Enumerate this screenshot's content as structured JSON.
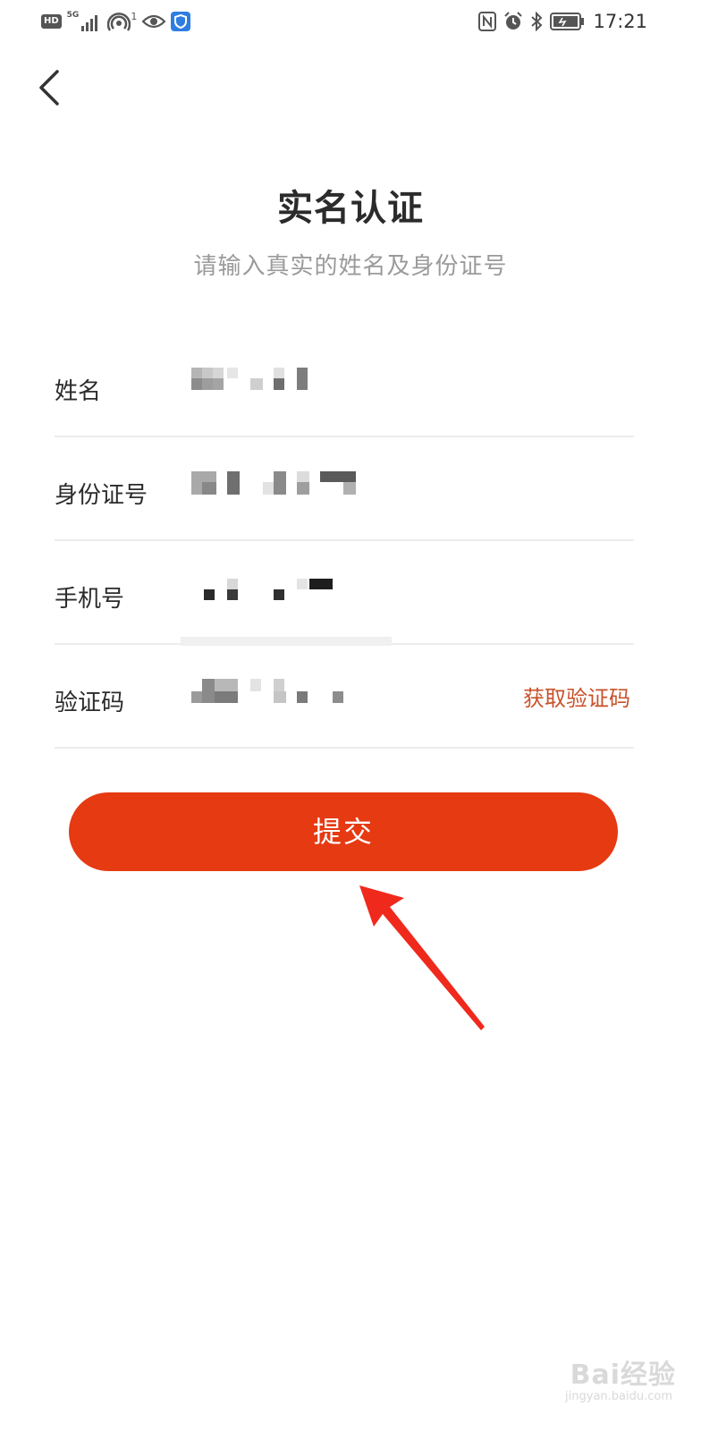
{
  "status_bar": {
    "hd_label": "HD",
    "network_label": "5G",
    "hotspot_count": "1",
    "time": "17:21",
    "icons": [
      "hd-badge",
      "signal-icon",
      "hotspot-icon",
      "eye-icon",
      "shield-app-icon",
      "nfc-icon",
      "alarm-icon",
      "bluetooth-icon",
      "battery-icon"
    ]
  },
  "header": {
    "back_icon": "chevron-left-icon",
    "title": "实名认证",
    "subtitle": "请输入真实的姓名及身份证号"
  },
  "form": {
    "fields": [
      {
        "label": "姓名",
        "value_state": "pixelated"
      },
      {
        "label": "身份证号",
        "value_state": "pixelated"
      },
      {
        "label": "手机号",
        "value_state": "pixelated"
      },
      {
        "label": "验证码",
        "value_state": "pixelated",
        "action_label": "获取验证码"
      }
    ]
  },
  "submit": {
    "label": "提交"
  },
  "colors": {
    "accent": "#e63a12",
    "link": "#c8522a",
    "title": "#2b2b2b",
    "subtitle": "#9a9a9a",
    "divider": "#ececec"
  },
  "watermark": {
    "main": "Bai经验",
    "sub": "jingyan.baidu.com"
  }
}
